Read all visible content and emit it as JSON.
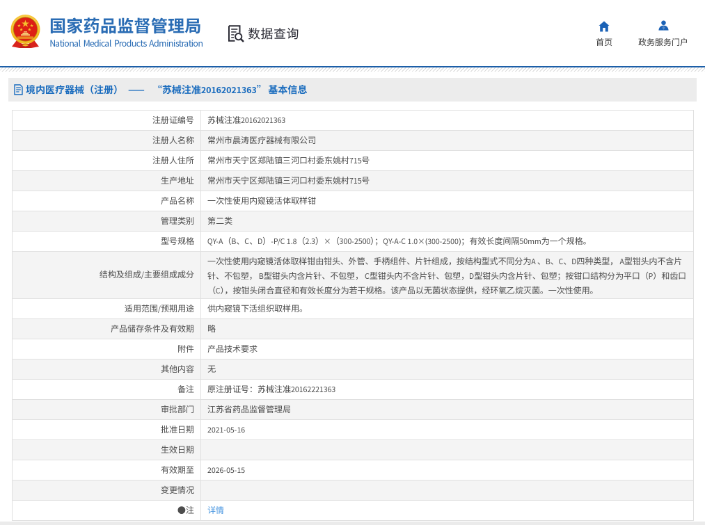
{
  "header": {
    "org_name_cn": "国家药品监督管理局",
    "org_name_en": "National Medical Products Administration",
    "section_label": "数据查询",
    "nav_home_label": "首页",
    "nav_portal_label": "政务服务门户"
  },
  "breadcrumb": {
    "category": "境内医疗器械（注册）",
    "separator": "——",
    "title": "“苏械注准20162021363” 基本信息"
  },
  "table": {
    "rows": [
      {
        "label": "注册证编号",
        "value": "苏械注准20162021363"
      },
      {
        "label": "注册人名称",
        "value": "常州市晨涛医疗器械有限公司"
      },
      {
        "label": "注册人住所",
        "value": "常州市天宁区郑陆镇三河口村委东姚村715号"
      },
      {
        "label": "生产地址",
        "value": "常州市天宁区郑陆镇三河口村委东姚村715号"
      },
      {
        "label": "产品名称",
        "value": "一次性使用内窥镜活体取样钳"
      },
      {
        "label": "管理类别",
        "value": "第二类"
      },
      {
        "label": "型号规格",
        "value": "QY-A（B、C、D）-P/C 1.8（2.3）×（300-2500）；QY-A-C 1.0×(300-2500)；有效长度间隔50mm为一个规格。"
      },
      {
        "label": "结构及组成/主要组成成分",
        "value": "一次性使用内窥镜活体取样钳由钳头、外管、手柄组件、片针组成，按结构型式不同分为A 、B、C、D四种类型， A型钳头内不含片针、不包塑， B型钳头内含片针、不包塑， C型钳头内不含片针、包塑，D型钳头内含片针、包塑；按钳口结构分为平口（P）和齿口（C），按钳头闭合直径和有效长度分为若干规格。该产品以无菌状态提供，经环氧乙烷灭菌。一次性使用。",
        "multiline": true
      },
      {
        "label": "适用范围/预期用途",
        "value": "供内窥镜下活组织取样用。"
      },
      {
        "label": "产品储存条件及有效期",
        "value": "略"
      },
      {
        "label": "附件",
        "value": "产品技术要求"
      },
      {
        "label": "其他内容",
        "value": "无"
      },
      {
        "label": "备注",
        "value": "原注册证号：苏械注准20162221363"
      },
      {
        "label": "审批部门",
        "value": "江苏省药品监督管理局"
      },
      {
        "label": "批准日期",
        "value": "2021-05-16"
      },
      {
        "label": "生效日期",
        "value": ""
      },
      {
        "label": "有效期至",
        "value": "2026-05-15"
      },
      {
        "label": "变更情况",
        "value": ""
      },
      {
        "label": "●注",
        "value": "详情",
        "link": true
      }
    ]
  },
  "colors": {
    "brand_blue": "#2a6cb4",
    "rule_blue": "#1c5fa8",
    "breadcrumb_blue": "#1a6cbe",
    "icon_blue": "#1b62b6",
    "link_blue": "#4896e0",
    "text_gray": "#4d4d4d",
    "stripe_gray": "#f4f4f4",
    "border_gray": "#e0e0e0"
  }
}
